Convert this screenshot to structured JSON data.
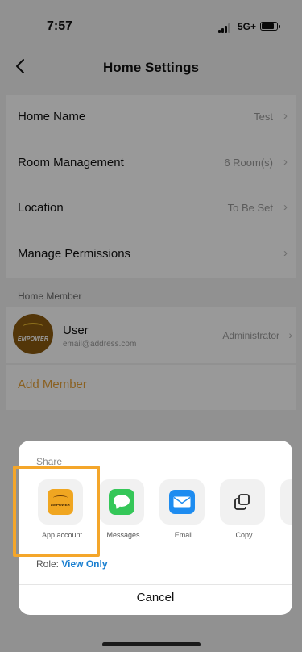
{
  "status": {
    "time": "7:57",
    "network": "5G+"
  },
  "nav": {
    "title": "Home Settings"
  },
  "settings": [
    {
      "label": "Home Name",
      "value": "Test"
    },
    {
      "label": "Room Management",
      "value": "6 Room(s)"
    },
    {
      "label": "Location",
      "value": "To Be Set"
    },
    {
      "label": "Manage Permissions",
      "value": ""
    }
  ],
  "members": {
    "header": "Home Member",
    "user": {
      "name": "User",
      "email": "email@address.com",
      "role": "Administrator",
      "avatar_text": "EMPOWER"
    },
    "add_label": "Add Member"
  },
  "share_sheet": {
    "label": "Share",
    "apps": [
      {
        "name": "App account",
        "icon": "empower-app-icon",
        "logo_text": "EMPOWER"
      },
      {
        "name": "Messages",
        "icon": "messages-icon"
      },
      {
        "name": "Email",
        "icon": "mail-icon"
      },
      {
        "name": "Copy",
        "icon": "copy-icon"
      }
    ],
    "role_label": "Role:",
    "role_value": "View Only",
    "cancel": "Cancel"
  },
  "colors": {
    "accent": "#e7a23a",
    "link": "#1a7fd0",
    "highlight": "#f4a62a",
    "messages": "#35c759",
    "mail": "#1e8cf0"
  }
}
